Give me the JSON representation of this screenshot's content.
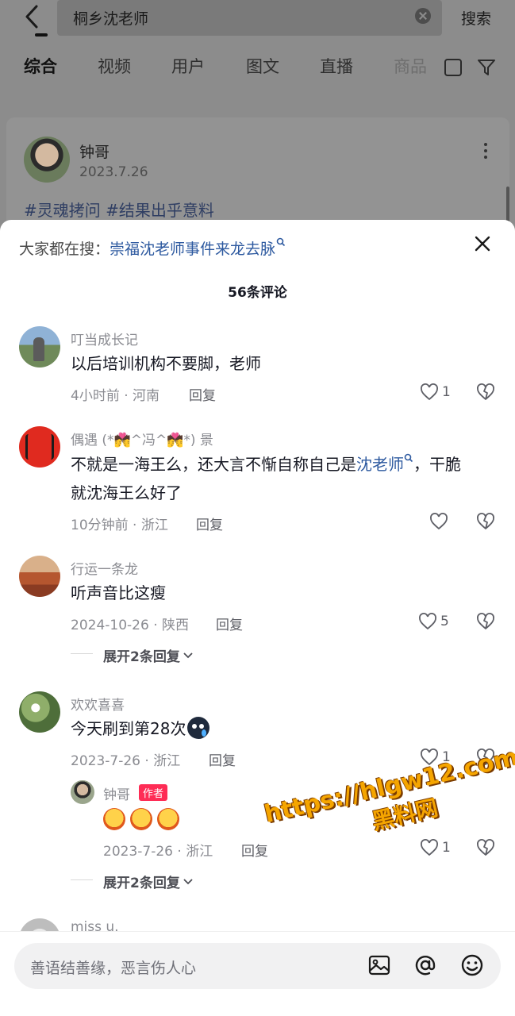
{
  "header": {
    "search_value": "桐乡沈老师",
    "search_button": "搜索"
  },
  "tabs": [
    "综合",
    "视频",
    "用户",
    "图文",
    "直播",
    "商品"
  ],
  "post": {
    "author": "钟哥",
    "date": "2023.7.26",
    "tags": "#灵魂拷问 #结果出乎意料"
  },
  "sheet": {
    "everyone_label": "大家都在搜：",
    "everyone_link": "崇福沈老师事件来龙去脉",
    "count": "56条评论",
    "reply_label": "回复",
    "comments": [
      {
        "user": "叮当成长记",
        "text": "以后培训机构不要脚，老师",
        "meta": "4小时前 · 河南",
        "likes": "1"
      },
      {
        "user": "偶遇 (*💏^冯^💏*) 景",
        "text_before": "不就是一海王么，还大言不惭自称自己是",
        "text_link": "沈老师",
        "text_after": "，干脆",
        "text_line2": "就沈海王么好了",
        "meta": "10分钟前 · 浙江",
        "likes": ""
      },
      {
        "user": "行运一条龙",
        "text": "听声音比这瘦",
        "meta": "2024-10-26 · 陕西",
        "likes": "5",
        "expand": "展开2条回复"
      },
      {
        "user": "欢欢喜喜",
        "text": "今天刷到第28次",
        "meta": "2023-7-26 · 浙江",
        "likes": "1",
        "reply": {
          "user": "钟哥",
          "badge": "作者",
          "meta": "2023-7-26 · 浙江",
          "likes": "1"
        },
        "expand": "展开2条回复"
      },
      {
        "user": "miss u."
      }
    ]
  },
  "watermark": {
    "line1": "https://hlgw12.com",
    "line2": "黑料网"
  },
  "input": {
    "placeholder": "善语结善缘，恶言伤人心"
  },
  "colors": {
    "link": "#2e5aa0",
    "badge": "#fe2c55",
    "watermark": "#f5a500"
  }
}
